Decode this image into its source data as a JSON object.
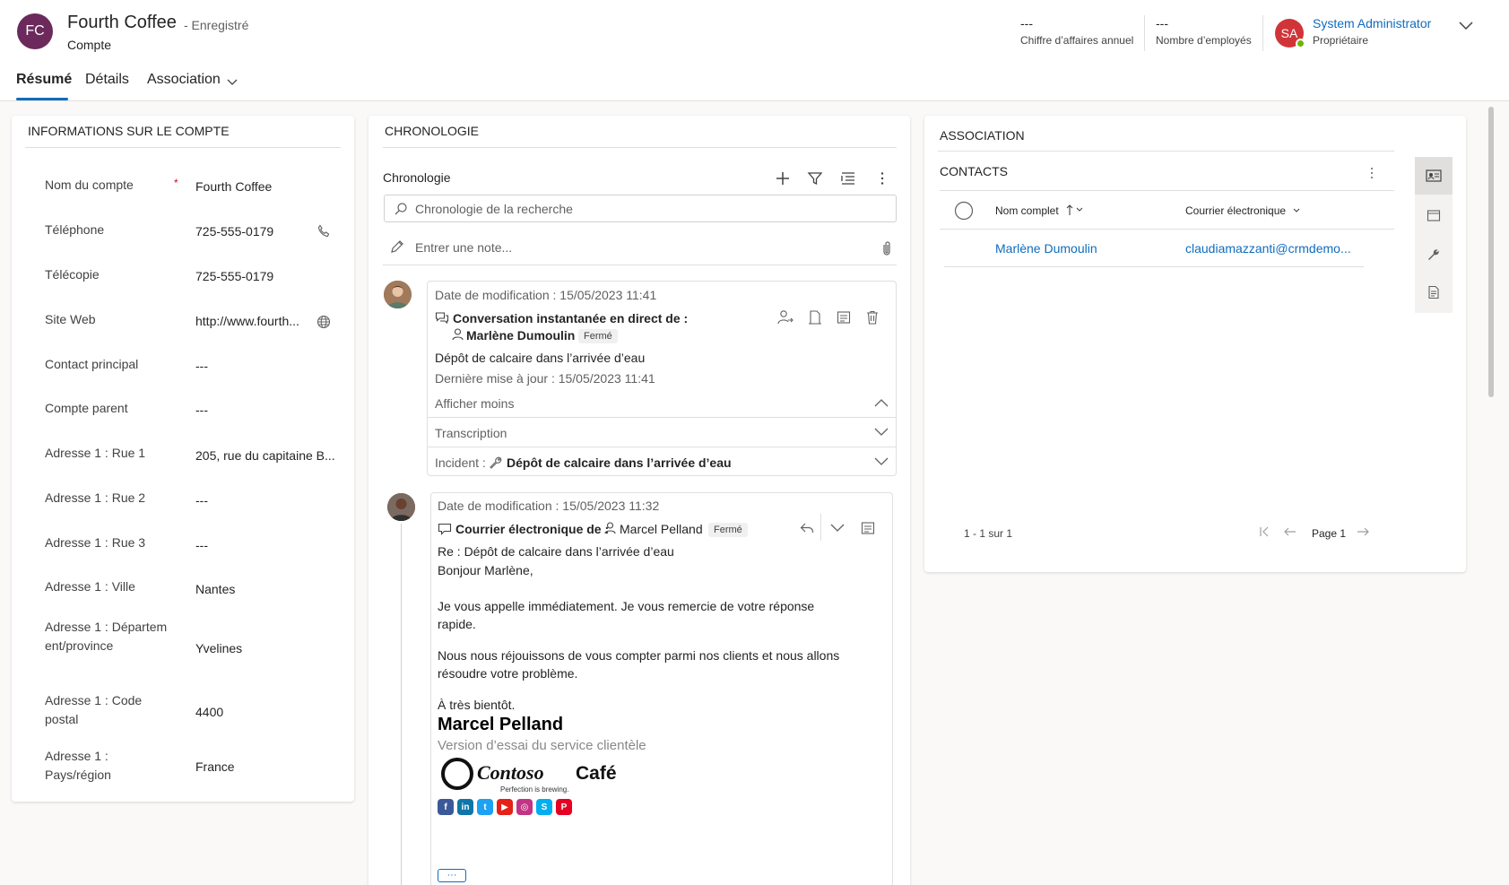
{
  "header": {
    "avatar_initials": "FC",
    "title": "Fourth Coffee",
    "saved_status": "- Enregistré",
    "entity": "Compte",
    "kpis": [
      {
        "value": "---",
        "label": "Chiffre d’affaires annuel"
      },
      {
        "value": "---",
        "label": "Nombre d’employés"
      }
    ],
    "owner": {
      "initials": "SA",
      "name": "System Administrator",
      "role": "Propriétaire"
    }
  },
  "tabs": [
    {
      "label": "Résumé"
    },
    {
      "label": "Détails"
    },
    {
      "label": "Association"
    }
  ],
  "account_info": {
    "title": "INFORMATIONS SUR LE COMPTE",
    "required_mark": "*",
    "fields": [
      {
        "label": "Nom du compte",
        "value": "Fourth Coffee"
      },
      {
        "label": "Téléphone",
        "value": "725-555-0179"
      },
      {
        "label": "Télécopie",
        "value": "725-555-0179"
      },
      {
        "label": "Site Web",
        "value": "http://www.fourth..."
      },
      {
        "label": "Contact principal",
        "value": "---"
      },
      {
        "label": "Compte parent",
        "value": "---"
      },
      {
        "label": "Adresse 1 : Rue 1",
        "value": "205, rue du capitaine B..."
      },
      {
        "label": "Adresse 1 : Rue 2",
        "value": "---"
      },
      {
        "label": "Adresse 1 : Rue 3",
        "value": "---"
      },
      {
        "label": "Adresse 1 : Ville",
        "value": "Nantes"
      },
      {
        "label": "Adresse 1 : Département/province",
        "value": "Yvelines"
      },
      {
        "label": "Adresse 1 : Code postal",
        "value": "4400"
      },
      {
        "label": "Adresse 1 : Pays/région",
        "value": "France"
      }
    ]
  },
  "timeline": {
    "section_title": "CHRONOLOGIE",
    "label": "Chronologie",
    "search_placeholder": "Chronologie de la recherche",
    "note_placeholder": "Entrer une note...",
    "entries": [
      {
        "modified": "Date de modification : 15/05/2023 11:41",
        "title": "Conversation instantanée en direct de :",
        "person": "Marlène Dumoulin",
        "status": "Fermé",
        "subject": "Dépôt de calcaire dans l’arrivée d’eau",
        "last_update": "Dernière mise à jour : 15/05/2023 11:41",
        "show_less": "Afficher moins",
        "transcript": "Transcription",
        "incident_label": "Incident :",
        "incident_value": "Dépôt de calcaire dans l’arrivée d’eau"
      },
      {
        "modified": "Date de modification : 15/05/2023 11:32",
        "title": "Courrier électronique de :",
        "person": "Marcel Pelland",
        "status": "Fermé",
        "subject": "Re : Dépôt de calcaire dans l’arrivée d’eau",
        "body": [
          "Bonjour Marlène,",
          "Je vous appelle immédiatement. Je vous remercie de votre réponse",
          "rapide.",
          "Nous nous réjouissons de vous compter parmi nos clients et nous allons",
          "résoudre votre problème.",
          "À très bientôt."
        ],
        "signature_name": "Marcel Pelland",
        "signature_role": "Version d’essai du service clientèle",
        "logo_text": "Contoso",
        "logo_suffix": "Café",
        "logo_tagline": "Perfection is brewing.",
        "more": "···"
      }
    ]
  },
  "association": {
    "section_title": "ASSOCIATION",
    "contacts_title": "CONTACTS",
    "columns": [
      {
        "label": "Nom complet"
      },
      {
        "label": "Courrier électronique"
      }
    ],
    "rows": [
      {
        "name": "Marlène Dumoulin",
        "email": "claudiamazzanti@crmdemo..."
      }
    ],
    "record_count": "1 - 1 sur 1",
    "page": "Page 1"
  },
  "colors": {
    "accent": "#0f6cbd",
    "fc_avatar": "#6b2a5b",
    "sa_avatar": "#d13438",
    "required": "#c50f1f",
    "presence": "#6bb700"
  }
}
